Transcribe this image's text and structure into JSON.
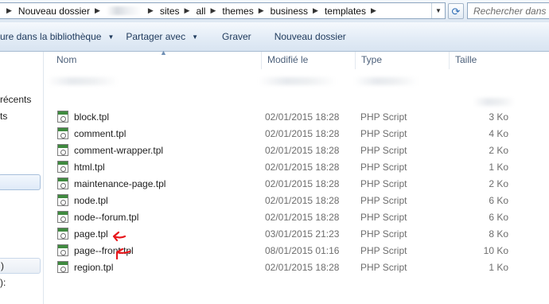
{
  "address_bar": {
    "breadcrumbs": [
      "Nouveau dossier",
      "",
      "sites",
      "all",
      "themes",
      "business",
      "templates"
    ],
    "search_placeholder": "Rechercher dans : templates"
  },
  "toolbar": {
    "buttons": [
      {
        "label": "ure dans la bibliothèque",
        "has_dropdown": true
      },
      {
        "label": "Partager avec",
        "has_dropdown": true
      },
      {
        "label": "Graver",
        "has_dropdown": false
      },
      {
        "label": "Nouveau dossier",
        "has_dropdown": false
      }
    ]
  },
  "nav_pane": {
    "items": [
      "récents",
      "ts",
      ")",
      "):"
    ]
  },
  "columns": {
    "name": "Nom",
    "modified": "Modifié le",
    "type": "Type",
    "size": "Taille"
  },
  "files": [
    {
      "name": "block.tpl",
      "modified": "02/01/2015 18:28",
      "type": "PHP Script",
      "size": "3 Ko",
      "icon": "php-file-icon"
    },
    {
      "name": "comment.tpl",
      "modified": "02/01/2015 18:28",
      "type": "PHP Script",
      "size": "4 Ko",
      "icon": "php-file-icon"
    },
    {
      "name": "comment-wrapper.tpl",
      "modified": "02/01/2015 18:28",
      "type": "PHP Script",
      "size": "2 Ko",
      "icon": "php-file-icon"
    },
    {
      "name": "html.tpl",
      "modified": "02/01/2015 18:28",
      "type": "PHP Script",
      "size": "1 Ko",
      "icon": "php-file-icon"
    },
    {
      "name": "maintenance-page.tpl",
      "modified": "02/01/2015 18:28",
      "type": "PHP Script",
      "size": "2 Ko",
      "icon": "php-file-icon"
    },
    {
      "name": "node.tpl",
      "modified": "02/01/2015 18:28",
      "type": "PHP Script",
      "size": "6 Ko",
      "icon": "php-file-icon"
    },
    {
      "name": "node--forum.tpl",
      "modified": "02/01/2015 18:28",
      "type": "PHP Script",
      "size": "6 Ko",
      "icon": "php-file-icon"
    },
    {
      "name": "page.tpl",
      "modified": "03/01/2015 21:23",
      "type": "PHP Script",
      "size": "8 Ko",
      "icon": "php-file-icon"
    },
    {
      "name": "page--front.tpl",
      "modified": "08/01/2015 01:16",
      "type": "PHP Script",
      "size": "10 Ko",
      "icon": "php-file-icon"
    },
    {
      "name": "region.tpl",
      "modified": "02/01/2015 18:28",
      "type": "PHP Script",
      "size": "1 Ko",
      "icon": "php-file-icon"
    }
  ],
  "colors": {
    "annotation": "#e8161b",
    "toolbar_text": "#1e395b",
    "header_text": "#4c607a",
    "detail_text": "#6d6d6d"
  }
}
